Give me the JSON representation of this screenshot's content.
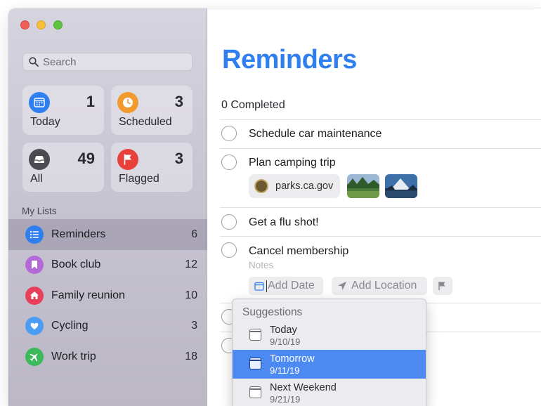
{
  "sidebar": {
    "search_placeholder": "Search",
    "tiles": [
      {
        "label": "Today",
        "count": "1",
        "color": "#2f7ff0",
        "icon": "calendar-icon"
      },
      {
        "label": "Scheduled",
        "count": "3",
        "color": "#f29a2e",
        "icon": "clock-icon"
      },
      {
        "label": "All",
        "count": "49",
        "color": "#4b4a50",
        "icon": "tray-icon"
      },
      {
        "label": "Flagged",
        "count": "3",
        "color": "#e8403a",
        "icon": "flag-icon"
      }
    ],
    "my_lists_label": "My Lists",
    "lists": [
      {
        "name": "Reminders",
        "count": "6",
        "color": "#2f7ff0",
        "icon": "list-icon",
        "selected": true
      },
      {
        "name": "Book club",
        "count": "12",
        "color": "#b36ad8",
        "icon": "bookmark-icon"
      },
      {
        "name": "Family reunion",
        "count": "10",
        "color": "#e8405a",
        "icon": "house-icon"
      },
      {
        "name": "Cycling",
        "count": "3",
        "color": "#4a9df2",
        "icon": "heart-icon"
      },
      {
        "name": "Work trip",
        "count": "18",
        "color": "#3cb95a",
        "icon": "airplane-icon"
      }
    ]
  },
  "main": {
    "title": "Reminders",
    "completed": "0 Completed",
    "items": [
      {
        "title": "Schedule car maintenance"
      },
      {
        "title": "Plan camping trip"
      },
      {
        "title": "Get a flu shot!"
      },
      {
        "title": "Cancel membership"
      }
    ],
    "link_chip": "parks.ca.gov",
    "notes_placeholder": "Notes",
    "add_date": "Add Date",
    "add_location": "Add Location"
  },
  "suggestions": {
    "header": "Suggestions",
    "items": [
      {
        "name": "Today",
        "date": "9/10/19"
      },
      {
        "name": "Tomorrow",
        "date": "9/11/19",
        "selected": true
      },
      {
        "name": "Next Weekend",
        "date": "9/21/19"
      }
    ]
  },
  "colors": {
    "accent": "#2f7ff0",
    "selection": "#4c8af2"
  }
}
